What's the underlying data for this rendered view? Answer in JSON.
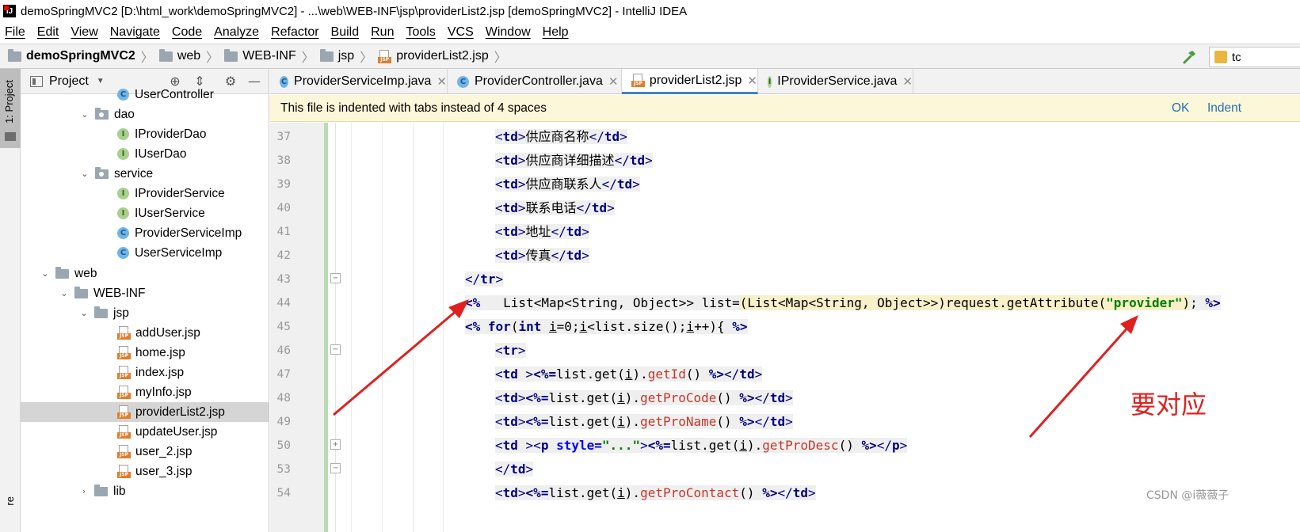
{
  "window": {
    "title": "demoSpringMVC2 [D:\\html_work\\demoSpringMVC2] - ...\\web\\WEB-INF\\jsp\\providerList2.jsp [demoSpringMVC2] - IntelliJ IDEA"
  },
  "menu": [
    "File",
    "Edit",
    "View",
    "Navigate",
    "Code",
    "Analyze",
    "Refactor",
    "Build",
    "Run",
    "Tools",
    "VCS",
    "Window",
    "Help"
  ],
  "breadcrumb": [
    "demoSpringMVC2",
    "web",
    "WEB-INF",
    "jsp",
    "providerList2.jsp"
  ],
  "toolbar": {
    "run_config_label": "tc"
  },
  "tool_stripe": {
    "project_label": "1: Project",
    "structure_label": "re"
  },
  "project_panel": {
    "title": "Project",
    "tree": [
      {
        "label": "UserController",
        "kind": "class"
      },
      {
        "label": "dao",
        "kind": "package"
      },
      {
        "label": "IProviderDao",
        "kind": "interface"
      },
      {
        "label": "IUserDao",
        "kind": "interface"
      },
      {
        "label": "service",
        "kind": "package"
      },
      {
        "label": "IProviderService",
        "kind": "interface"
      },
      {
        "label": "IUserService",
        "kind": "interface"
      },
      {
        "label": "ProviderServiceImp",
        "kind": "class"
      },
      {
        "label": "UserServiceImp",
        "kind": "class"
      },
      {
        "label": "web",
        "kind": "folder"
      },
      {
        "label": "WEB-INF",
        "kind": "folder"
      },
      {
        "label": "jsp",
        "kind": "folder"
      },
      {
        "label": "addUser.jsp",
        "kind": "jsp"
      },
      {
        "label": "home.jsp",
        "kind": "jsp"
      },
      {
        "label": "index.jsp",
        "kind": "jsp"
      },
      {
        "label": "myInfo.jsp",
        "kind": "jsp"
      },
      {
        "label": "providerList2.jsp",
        "kind": "jsp",
        "selected": true
      },
      {
        "label": "updateUser.jsp",
        "kind": "jsp"
      },
      {
        "label": "user_2.jsp",
        "kind": "jsp"
      },
      {
        "label": "user_3.jsp",
        "kind": "jsp"
      },
      {
        "label": "lib",
        "kind": "folder"
      }
    ]
  },
  "editor_tabs": [
    {
      "label": "ProviderServiceImp.java",
      "icon": "class",
      "active": false
    },
    {
      "label": "ProviderController.java",
      "icon": "class",
      "active": false
    },
    {
      "label": "providerList2.jsp",
      "icon": "jsp",
      "active": true
    },
    {
      "label": "IProviderService.java",
      "icon": "interface",
      "active": false
    }
  ],
  "banner": {
    "text": "This file is indented with tabs instead of 4 spaces",
    "ok_label": "OK",
    "indent_label": "Indent"
  },
  "editor": {
    "line_numbers": [
      "37",
      "38",
      "39",
      "40",
      "41",
      "42",
      "43",
      "44",
      "45",
      "46",
      "47",
      "48",
      "49",
      "50",
      "53",
      "54"
    ],
    "th_cells": [
      "供应商名称",
      "供应商详细描述",
      "供应商联系人",
      "联系电话",
      "地址",
      "传真"
    ],
    "attr_key": "provider",
    "fold_placeholder": "...",
    "getters": [
      "getId",
      "getProCode",
      "getProName",
      "getProDesc",
      "getProContact"
    ]
  },
  "annotation": {
    "text": "要对应",
    "color": "#e02020"
  },
  "watermark": "CSDN @i薇薇子"
}
